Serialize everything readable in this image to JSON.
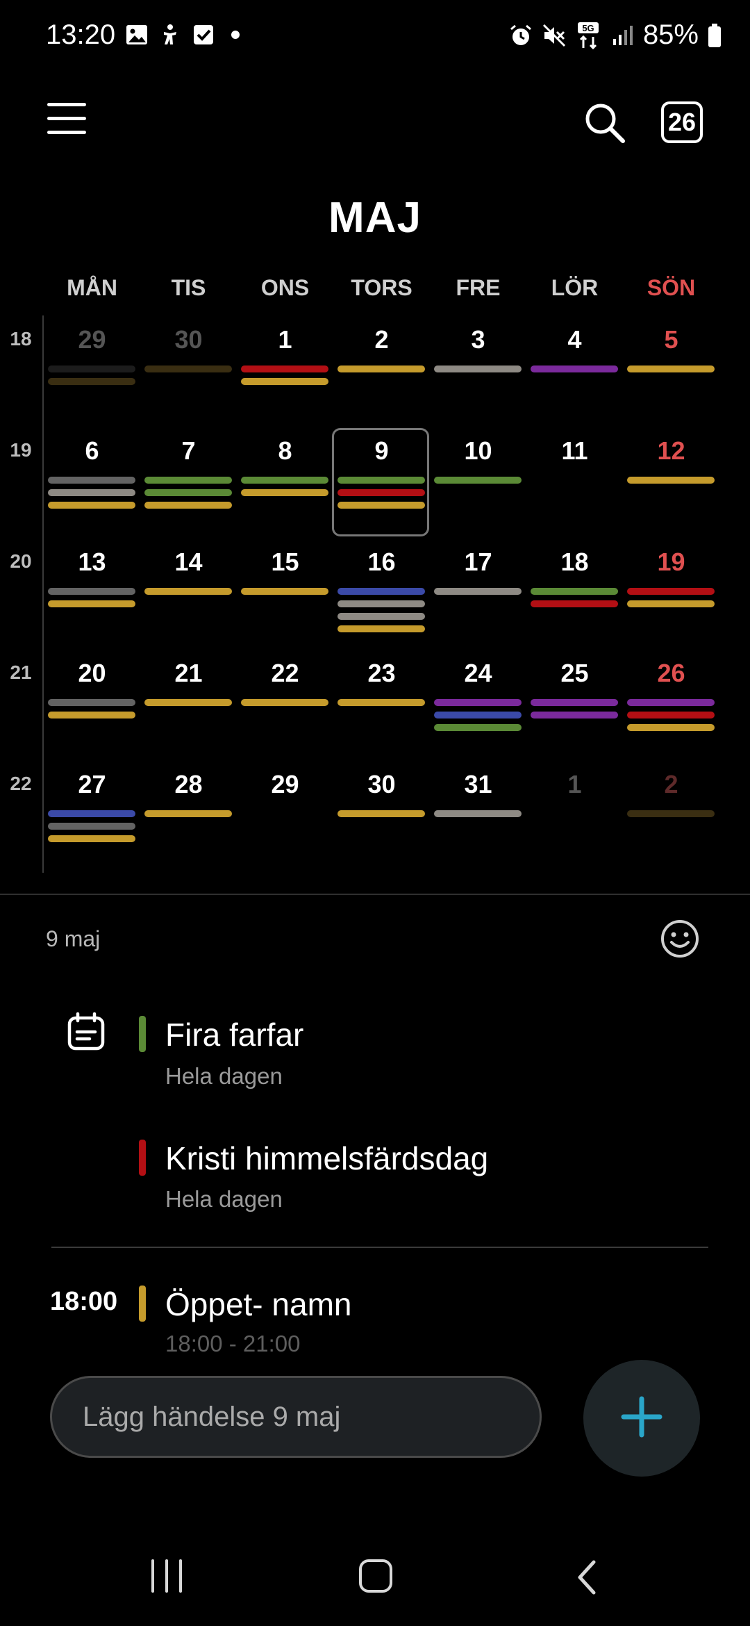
{
  "status_bar": {
    "time": "13:20",
    "battery": "85%",
    "left_icons": [
      "gallery-icon",
      "accessibility-icon",
      "checkbox-icon",
      "dot-icon"
    ],
    "right_icons": [
      "alarm-icon",
      "mute-icon",
      "network-5g-icon",
      "signal-icon",
      "battery-icon"
    ]
  },
  "toolbar": {
    "menu_icon": "hamburger-menu-icon",
    "search_icon": "search-icon",
    "today_label": "26"
  },
  "month_title": "MAJ",
  "weekdays": [
    "MÅN",
    "TIS",
    "ONS",
    "TORS",
    "FRE",
    "LÖR",
    "SÖN"
  ],
  "colors": {
    "yellow": "#c59b2c",
    "gray": "#8e8a84",
    "darkgray": "#636363",
    "red": "#b30f14",
    "purple": "#7b2a9c",
    "green": "#5b8a36",
    "blue": "#3b4aa8",
    "dimbrown": "#3a2e12",
    "dimgray": "#1c1c1c",
    "sunday": "#e05050",
    "accent_fab": "#2aa6c9"
  },
  "weeks": [
    {
      "week_number": "18",
      "days": [
        {
          "num": "29",
          "dim": true,
          "bars": [
            "dimgray",
            "dimbrown"
          ]
        },
        {
          "num": "30",
          "dim": true,
          "bars": [
            "dimbrown"
          ]
        },
        {
          "num": "1",
          "bars": [
            "red",
            "yellow"
          ]
        },
        {
          "num": "2",
          "bars": [
            "yellow"
          ]
        },
        {
          "num": "3",
          "bars": [
            "gray"
          ]
        },
        {
          "num": "4",
          "bars": [
            "purple"
          ]
        },
        {
          "num": "5",
          "sun": true,
          "bars": [
            "yellow"
          ]
        }
      ]
    },
    {
      "week_number": "19",
      "days": [
        {
          "num": "6",
          "bars": [
            "darkgray",
            "gray",
            "yellow"
          ]
        },
        {
          "num": "7",
          "bars": [
            "green",
            "green",
            "yellow"
          ]
        },
        {
          "num": "8",
          "bars": [
            "green",
            "yellow"
          ]
        },
        {
          "num": "9",
          "selected": true,
          "bars": [
            "green",
            "red",
            "yellow"
          ]
        },
        {
          "num": "10",
          "bars": [
            "green"
          ]
        },
        {
          "num": "11",
          "bars": []
        },
        {
          "num": "12",
          "sun": true,
          "bars": [
            "yellow"
          ]
        }
      ]
    },
    {
      "week_number": "20",
      "days": [
        {
          "num": "13",
          "bars": [
            "darkgray",
            "yellow"
          ]
        },
        {
          "num": "14",
          "bars": [
            "yellow"
          ]
        },
        {
          "num": "15",
          "bars": [
            "yellow"
          ]
        },
        {
          "num": "16",
          "bars": [
            "blue",
            "gray",
            "gray",
            "yellow"
          ]
        },
        {
          "num": "17",
          "bars": [
            "gray"
          ]
        },
        {
          "num": "18",
          "bars": [
            "green",
            "red"
          ]
        },
        {
          "num": "19",
          "sun": true,
          "bars": [
            "red",
            "yellow"
          ]
        }
      ]
    },
    {
      "week_number": "21",
      "days": [
        {
          "num": "20",
          "bars": [
            "darkgray",
            "yellow"
          ]
        },
        {
          "num": "21",
          "bars": [
            "yellow"
          ]
        },
        {
          "num": "22",
          "bars": [
            "yellow"
          ]
        },
        {
          "num": "23",
          "bars": [
            "yellow"
          ]
        },
        {
          "num": "24",
          "bars": [
            "purple",
            "blue",
            "green"
          ]
        },
        {
          "num": "25",
          "bars": [
            "purple",
            "purple"
          ]
        },
        {
          "num": "26",
          "sun": true,
          "bars": [
            "purple",
            "red",
            "yellow"
          ]
        }
      ]
    },
    {
      "week_number": "22",
      "days": [
        {
          "num": "27",
          "bars": [
            "blue",
            "darkgray",
            "yellow"
          ]
        },
        {
          "num": "28",
          "bars": [
            "yellow"
          ]
        },
        {
          "num": "29",
          "bars": []
        },
        {
          "num": "30",
          "bars": [
            "yellow"
          ]
        },
        {
          "num": "31",
          "bars": [
            "gray"
          ]
        },
        {
          "num": "1",
          "dim": true,
          "bars": []
        },
        {
          "num": "2",
          "dim": true,
          "sun": true,
          "bars": [
            "dimbrown"
          ]
        }
      ]
    }
  ],
  "agenda": {
    "date_label": "9 maj",
    "emoji_icon": "smiley-icon",
    "events": [
      {
        "title": "Fira farfar",
        "subtitle": "Hela dagen",
        "color": "green",
        "icon": "calendar-note-icon"
      },
      {
        "title": "Kristi himmelsfärdsdag",
        "subtitle": "Hela dagen",
        "color": "red"
      },
      {
        "time": "18:00",
        "title": "Öppet- namn",
        "subtitle": "18:00 - 21:00",
        "color": "yellow"
      }
    ]
  },
  "quick_add": {
    "placeholder": "Lägg händelse 9 maj",
    "fab_icon": "plus-icon"
  },
  "nav": {
    "recent_icon": "recent-apps-icon",
    "home_icon": "home-icon",
    "back_icon": "back-icon"
  }
}
